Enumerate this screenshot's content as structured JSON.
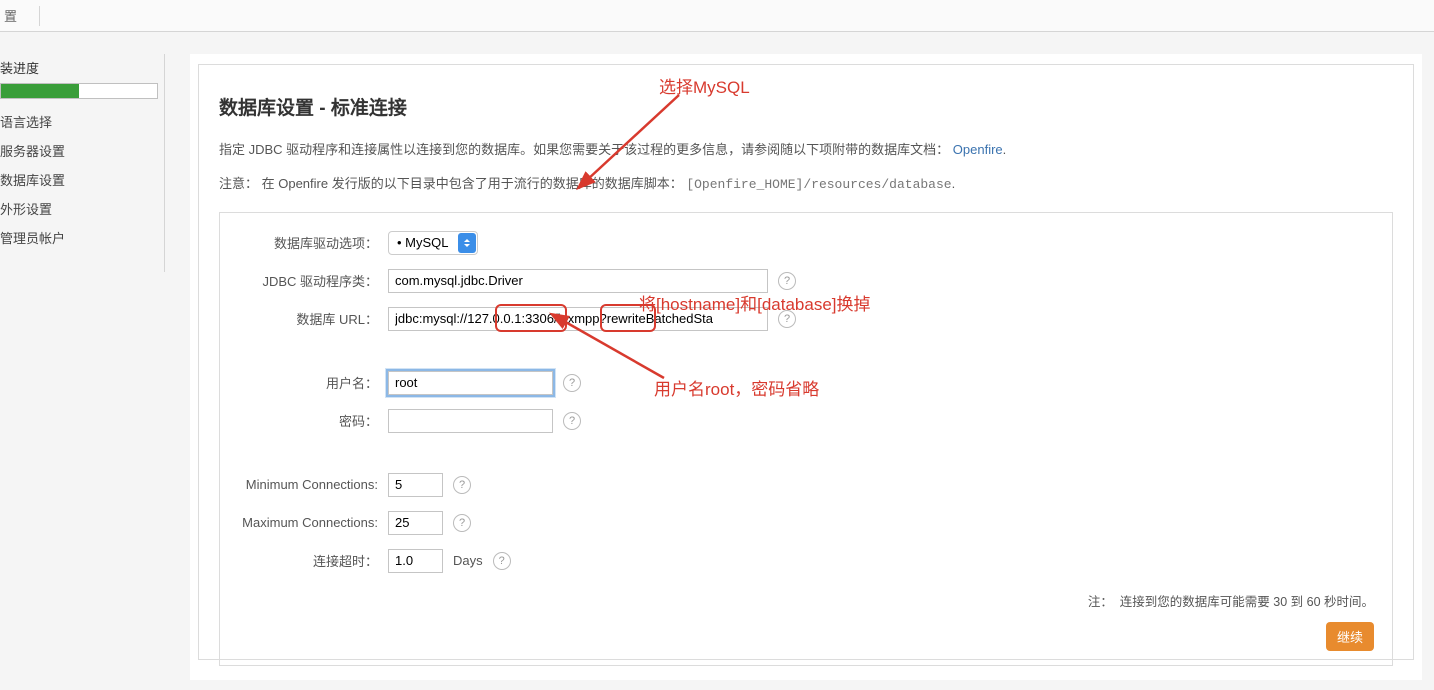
{
  "topbar": {
    "label": "置"
  },
  "sidebar": {
    "progress_label": "装进度",
    "progress_percent": 50,
    "items": [
      {
        "label": "语言选择"
      },
      {
        "label": "服务器设置"
      },
      {
        "label": "数据库设置"
      },
      {
        "label": "外形设置"
      },
      {
        "label": "管理员帐户"
      }
    ]
  },
  "page": {
    "title": "数据库设置 - 标准连接",
    "desc_before": "指定 JDBC 驱动程序和连接属性以连接到您的数据库。如果您需要关于该过程的更多信息，请参阅随以下项附带的数据库文档： ",
    "desc_link": "Openfire",
    "desc_after": ".",
    "note_prefix": "注意：  在 Openfire 发行版的以下目录中包含了用于流行的数据库的数据库脚本：",
    "note_path": "[Openfire_HOME]/resources/database",
    "note_suffix": "."
  },
  "form": {
    "preset_label": "数据库驱动选项：",
    "preset_value": "• MySQL",
    "driver_label": "JDBC 驱动程序类：",
    "driver_value": "com.mysql.jdbc.Driver",
    "url_label": "数据库 URL：",
    "url_value": "jdbc:mysql://127.0.0.1:3306/loxmpp?rewriteBatchedSta",
    "user_label": "用户名：",
    "user_value": "root",
    "pass_label": "密码：",
    "pass_value": "",
    "min_label": "Minimum Connections:",
    "min_value": "5",
    "max_label": "Maximum Connections:",
    "max_value": "25",
    "timeout_label": "连接超时：",
    "timeout_value": "1.0",
    "timeout_unit": "Days"
  },
  "footer": {
    "note_prefix": "注：",
    "note_text": "连接到您的数据库可能需要 30 到 60 秒时间。",
    "continue": "继续"
  },
  "annotations": {
    "select_mysql": "选择MySQL",
    "replace_host": "将[hostname]和[database]换掉",
    "user_pass": "用户名root，密码省略"
  }
}
